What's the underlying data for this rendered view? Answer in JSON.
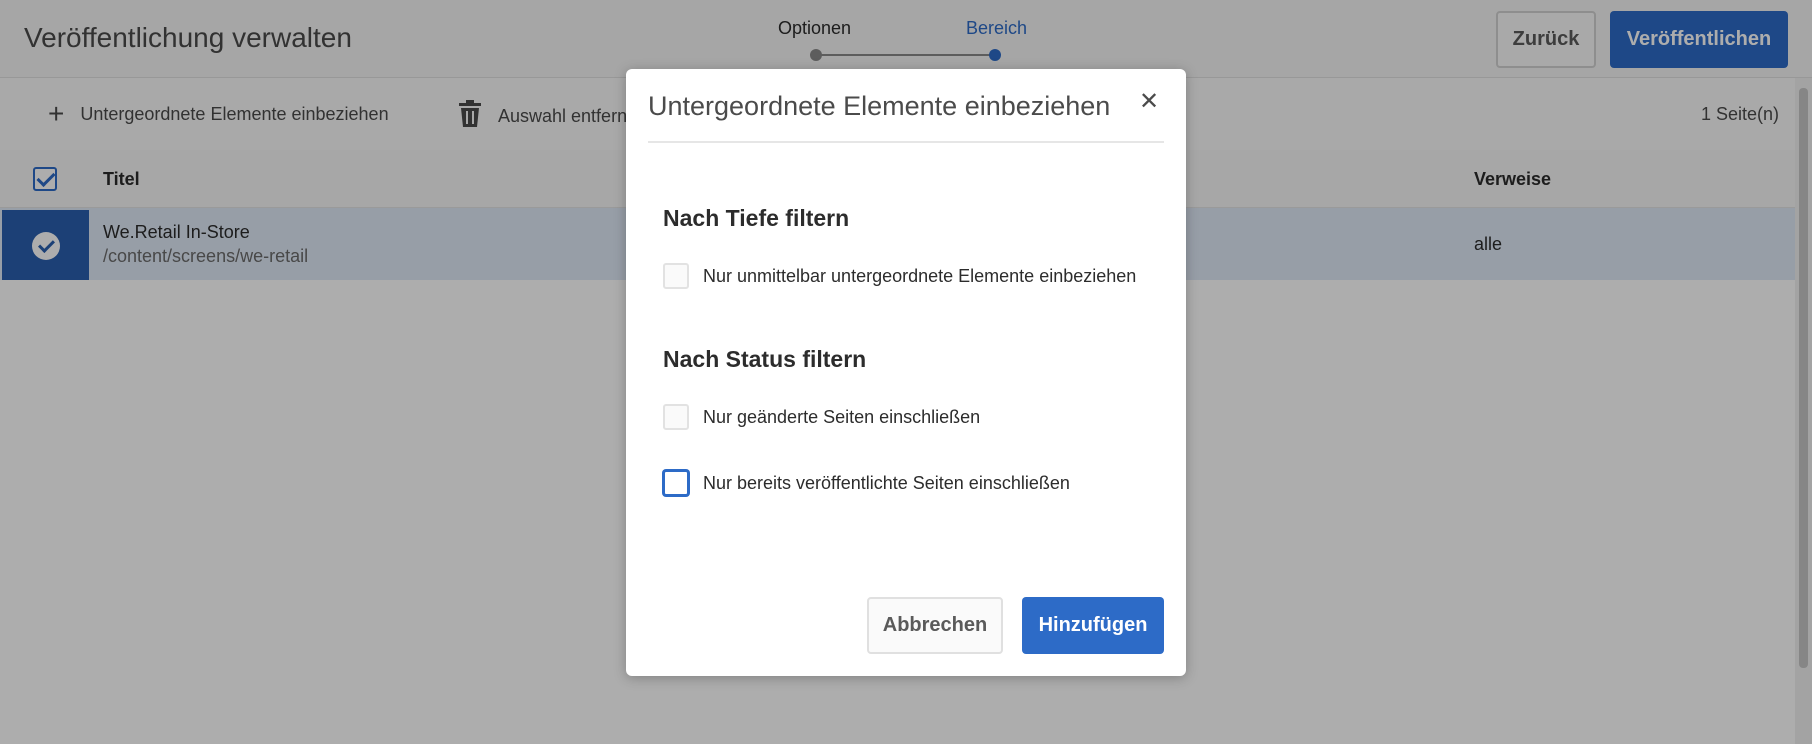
{
  "header": {
    "title": "Veröffentlichung verwalten",
    "steps": [
      {
        "label": "Optionen"
      },
      {
        "label": "Bereich"
      }
    ],
    "back_label": "Zurück",
    "publish_label": "Veröffentlichen"
  },
  "toolbar": {
    "add_children_label": "Untergeordnete Elemente einbeziehen",
    "add_children_icon": "plus-icon",
    "remove_selection_label": "Auswahl entfernen",
    "remove_selection_icon": "trash-icon",
    "page_count": "1 Seite(n)"
  },
  "table": {
    "columns": {
      "title": "Titel",
      "references": "Verweise"
    },
    "rows": [
      {
        "title": "We.Retail In-Store",
        "path": "/content/screens/we-retail",
        "references": "alle",
        "selected": true
      }
    ]
  },
  "dialog": {
    "title": "Untergeordnete Elemente einbeziehen",
    "close_icon": "close-icon",
    "depth_heading": "Nach Tiefe filtern",
    "depth_option": "Nur unmittelbar untergeordnete Elemente einbeziehen",
    "status_heading": "Nach Status filtern",
    "status_option_modified": "Nur geänderte Seiten einschließen",
    "status_option_published": "Nur bereits veröffentlichte Seiten einschließen",
    "cancel_label": "Abbrechen",
    "add_label": "Hinzufügen"
  },
  "colors": {
    "accent": "#2d6bc7",
    "overlay": "rgba(0,0,0,0.32)",
    "selected_row": "#dfe9f7"
  }
}
